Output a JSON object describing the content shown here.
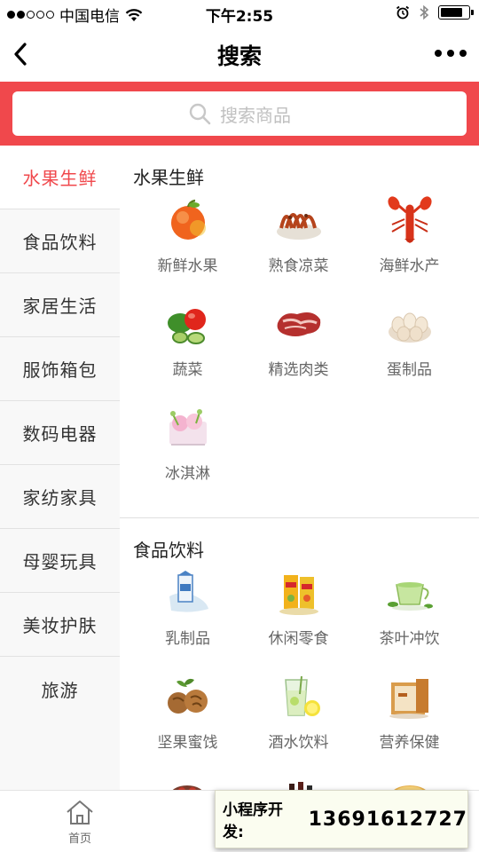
{
  "status_bar": {
    "carrier": "中国电信",
    "time": "下午2:55"
  },
  "nav": {
    "title": "搜索"
  },
  "search": {
    "placeholder": "搜索商品"
  },
  "sidebar": {
    "items": [
      {
        "label": "水果生鲜",
        "active": true
      },
      {
        "label": "食品饮料"
      },
      {
        "label": "家居生活"
      },
      {
        "label": "服饰箱包"
      },
      {
        "label": "数码电器"
      },
      {
        "label": "家纺家具"
      },
      {
        "label": "母婴玩具"
      },
      {
        "label": "美妆护肤"
      },
      {
        "label": "旅游"
      }
    ]
  },
  "sections": [
    {
      "title": "水果生鲜",
      "items": [
        {
          "label": "新鲜水果",
          "icon": "apple-icon"
        },
        {
          "label": "熟食凉菜",
          "icon": "cooked-food-icon"
        },
        {
          "label": "海鲜水产",
          "icon": "lobster-icon"
        },
        {
          "label": "蔬菜",
          "icon": "vegetables-icon"
        },
        {
          "label": "精选肉类",
          "icon": "meat-icon"
        },
        {
          "label": "蛋制品",
          "icon": "eggs-icon"
        },
        {
          "label": "冰淇淋",
          "icon": "ice-cream-icon"
        }
      ]
    },
    {
      "title": "食品饮料",
      "items": [
        {
          "label": "乳制品",
          "icon": "milk-icon"
        },
        {
          "label": "休闲零食",
          "icon": "snacks-icon"
        },
        {
          "label": "茶叶冲饮",
          "icon": "tea-icon"
        },
        {
          "label": "坚果蜜饯",
          "icon": "walnut-icon"
        },
        {
          "label": "酒水饮料",
          "icon": "drink-icon"
        },
        {
          "label": "营养保健",
          "icon": "health-box-icon"
        }
      ]
    }
  ],
  "tabbar": {
    "items": [
      {
        "label": "首页"
      }
    ]
  },
  "promo": {
    "label": "小程序开发:",
    "phone": "13691612727"
  },
  "colors": {
    "accent": "#f0484c"
  }
}
